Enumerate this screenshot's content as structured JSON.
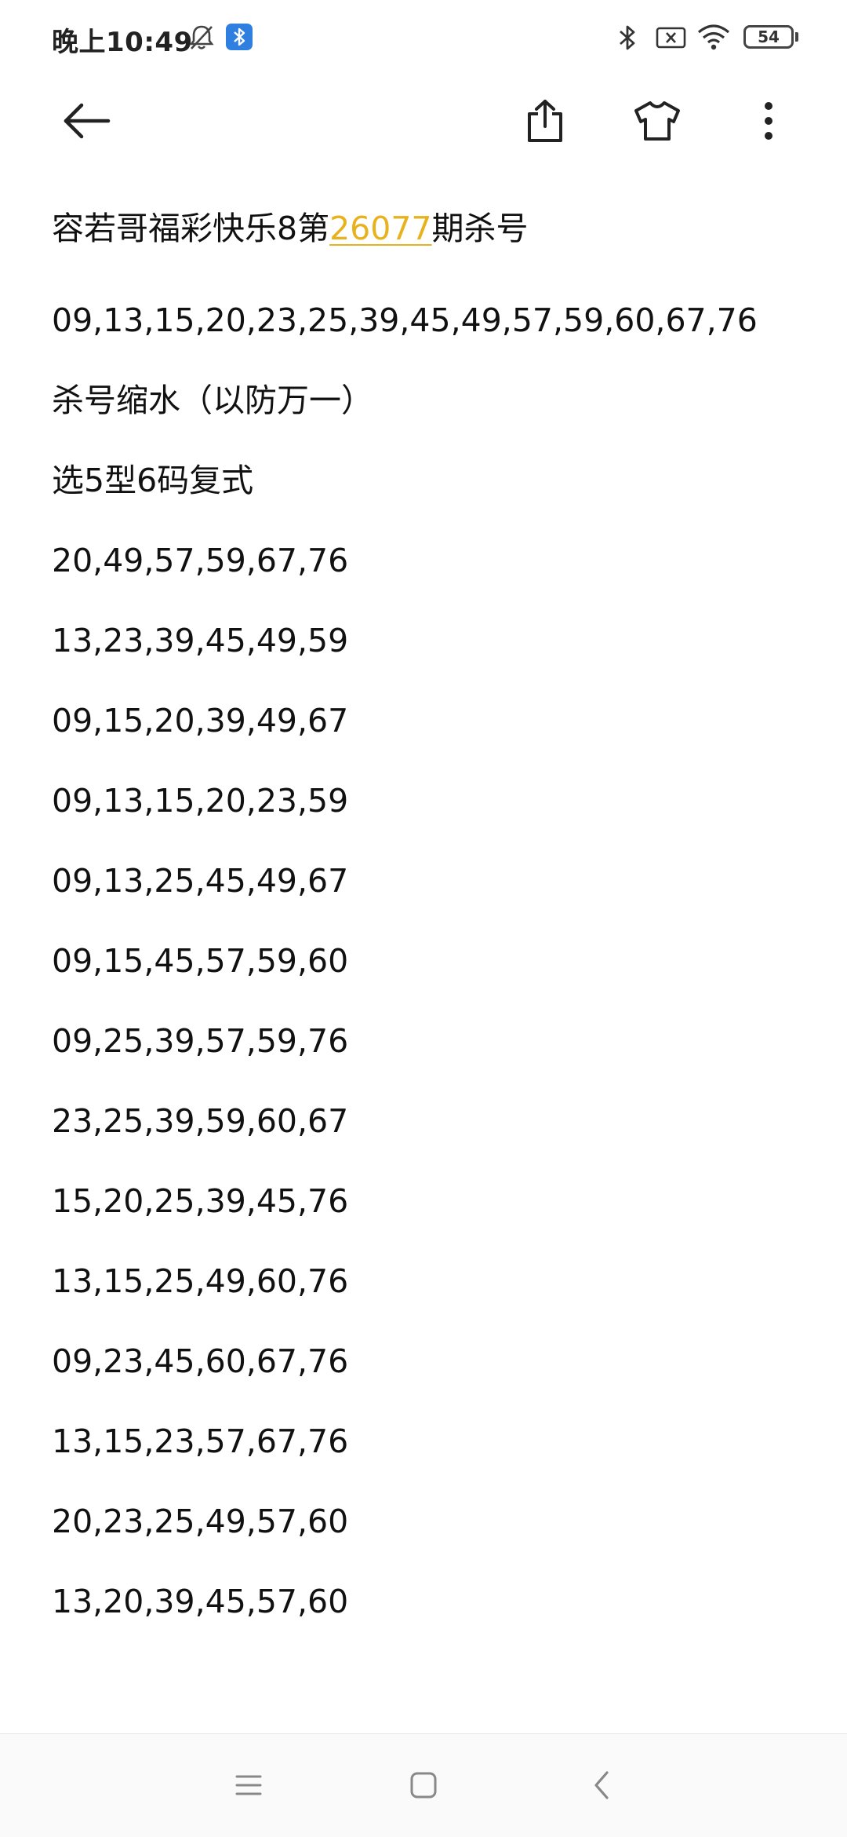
{
  "status_bar": {
    "time": "晚上10:49",
    "battery": "54",
    "icons": [
      "bell-off-icon",
      "bluetooth-badge-icon",
      "bluetooth-icon",
      "sim-card-icon",
      "wifi-icon",
      "battery-icon"
    ]
  },
  "toolbar": {
    "icons": [
      "back-arrow-icon",
      "share-icon",
      "tshirt-icon",
      "more-vertical-icon"
    ]
  },
  "note": {
    "title_prefix": "容若哥福彩快乐8第",
    "title_issue": "26077",
    "title_suffix": "期杀号",
    "lines": [
      "09,13,15,20,23,25,39,45,49,57,59,60,67,76",
      "杀号缩水（以防万一）",
      "选5型6码复式",
      "20,49,57,59,67,76",
      "13,23,39,45,49,59",
      "09,15,20,39,49,67",
      "09,13,15,20,23,59",
      "09,13,25,45,49,67",
      "09,15,45,57,59,60",
      "09,25,39,57,59,76",
      "23,25,39,59,60,67",
      "15,20,25,39,45,76",
      "13,15,25,49,60,76",
      "09,23,45,60,67,76",
      "13,15,23,57,67,76",
      "20,23,25,49,57,60",
      "13,20,39,45,57,60"
    ],
    "highlight_color": "#e8b21e"
  },
  "nav_bar": {
    "icons": [
      "menu-icon",
      "home-square-icon",
      "back-chevron-icon"
    ]
  }
}
